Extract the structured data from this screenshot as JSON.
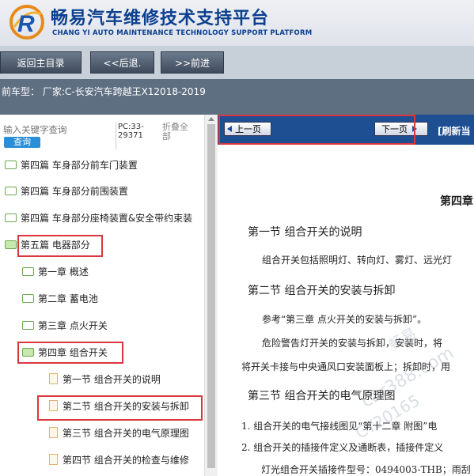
{
  "app": {
    "title_cn": "畅易汽车维修技术支持平台",
    "title_en": "CHANG YI AUTO MAINTENANCE TECHNOLOGY SUPPORT PLATFORM"
  },
  "nav": {
    "back_label": "返回主目录",
    "prev_label": "<<后退.",
    "next_label": ">>前进"
  },
  "vehicle": {
    "text": "前车型：  厂家:C-长安汽车跨越王X12018-2019"
  },
  "search": {
    "placeholder": "输入关键字查询",
    "button_label": "查询",
    "pc_code": "PC:33-29371",
    "collapse_label": "折叠全部"
  },
  "tree": {
    "items": [
      {
        "label": "第四篇 车身部分前车门装置"
      },
      {
        "label": "第四篇 车身部分前围装置"
      },
      {
        "label": "第四篇 车身部分座椅装置&安全带约束装"
      },
      {
        "label": "第五篇 电器部分"
      },
      {
        "label": "第一章 概述"
      },
      {
        "label": "第二章 蓄电池"
      },
      {
        "label": "第三章 点火开关"
      },
      {
        "label": "第四章 组合开关"
      },
      {
        "label": "第一节 组合开关的说明"
      },
      {
        "label": "第二节 组合开关的安装与拆卸"
      },
      {
        "label": "第三节 组合开关的电气原理图"
      },
      {
        "label": "第四节 组合开关的检查与维修"
      }
    ]
  },
  "pager": {
    "prev_label": "上一页",
    "next_label": "下一页",
    "refresh_label": "[刷新当"
  },
  "document": {
    "chapter": "第四章",
    "s1_title": "第一节  组合开关的说明",
    "s1_body": "组合开关包括照明灯、转向灯、雾灯、远光灯",
    "s2_title": "第二节  组合开关的安装与拆卸",
    "s2_body1": "参考“第三章  点火开关的安装与拆卸”。",
    "s2_body2": "危险警告灯开关的安装与拆卸，安装时，将",
    "s2_body3": "将开关卡接与中央通风口安装面板上；拆卸时，用",
    "s3_title": "第三节  组合开关的电气原理图",
    "s3_item1": "1.    组合开关的电气接线图见“第十二章  附图”电",
    "s3_item2": "2.    组合开关的插接件定义及通断表，插接件定义",
    "s3_item3": "灯光组合开关插接件型号：0494003-THB；雨刮"
  },
  "watermark": {
    "line1": "畅易",
    "line2": "car388.com",
    "line3": "CY20165"
  },
  "colors": {
    "brand_blue": "#0b3f8f",
    "highlight_red": "#d9363e",
    "pager_bg": "#1e4f93",
    "vehicle_bar": "#5f6f82"
  }
}
